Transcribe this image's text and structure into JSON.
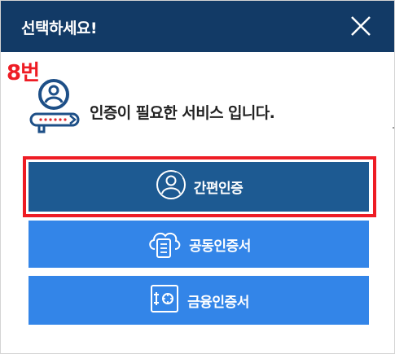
{
  "dialog": {
    "title": "선택하세요!",
    "close_icon": "close-icon"
  },
  "annotation": {
    "step_label": "8번",
    "color": "#ee1c24"
  },
  "message": {
    "text": "인증이 필요한 서비스 입니다.",
    "icon": "user-auth-icon"
  },
  "options": [
    {
      "label": "간편인증",
      "icon": "user-circle-icon",
      "color": "#1d5a92",
      "highlighted": true
    },
    {
      "label": "공동인증서",
      "icon": "cloud-certificate-icon",
      "color": "#3385e8",
      "highlighted": false
    },
    {
      "label": "금융인증서",
      "icon": "safe-icon",
      "color": "#3385e8",
      "highlighted": false
    }
  ],
  "colors": {
    "header": "#123a66",
    "primary_button": "#1d5a92",
    "secondary_button": "#3385e8"
  }
}
